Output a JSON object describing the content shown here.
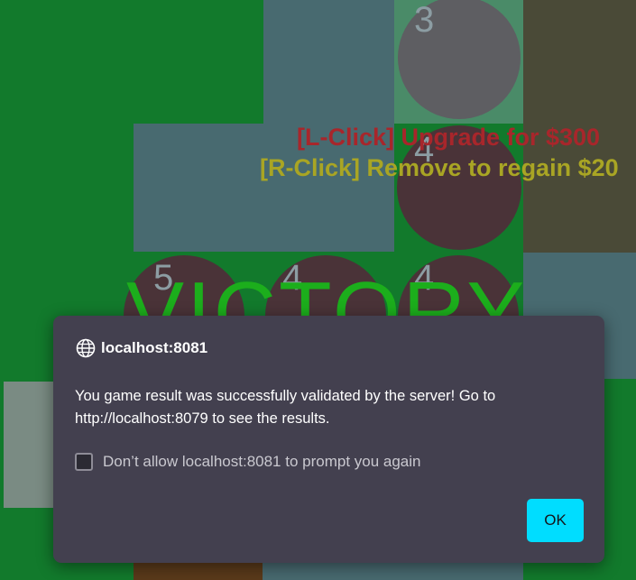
{
  "game": {
    "hint_upgrade": "[L-Click] Upgrade for $300",
    "hint_remove": "[R-Click] Remove to regain $20",
    "victory_text": "VICTORY",
    "tower_levels": {
      "top": "3",
      "middle": "4",
      "bottom_left": "5",
      "bottom_center": "4",
      "bottom_right": "4"
    }
  },
  "dialog": {
    "origin": "localhost:8081",
    "icon": "globe-icon",
    "message": "You game result was successfully validated by the server! Go to http://localhost:8079 to see the results.",
    "checkbox_label": "Don’t allow localhost:8081 to prompt you again",
    "checkbox_checked": false,
    "ok_label": "OK"
  },
  "colors": {
    "background_green": "#127a2c",
    "dialog_bg": "#43404f",
    "ok_button": "#00ddff",
    "upgrade_text": "#a8262b",
    "remove_text": "#a9a524",
    "victory_text": "#1cae1c"
  }
}
